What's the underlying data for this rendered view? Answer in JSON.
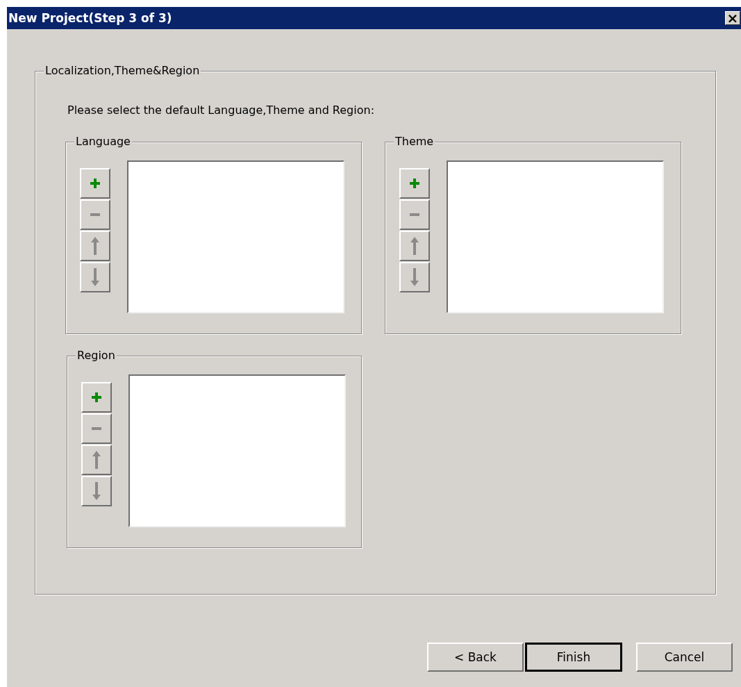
{
  "window": {
    "title": "New Project(Step 3 of 3)",
    "close": "×"
  },
  "group": {
    "legend": "Localization,Theme&Region",
    "instruction": "Please select the default Language,Theme and Region:",
    "lists": [
      {
        "legend": "Language",
        "tools": [
          {
            "kind": "add",
            "disabled": false
          },
          {
            "kind": "remove",
            "disabled": true
          },
          {
            "kind": "up",
            "disabled": true
          },
          {
            "kind": "down",
            "disabled": true
          }
        ]
      },
      {
        "legend": "Theme",
        "tools": [
          {
            "kind": "add",
            "disabled": false
          },
          {
            "kind": "remove",
            "disabled": true
          },
          {
            "kind": "up",
            "disabled": true
          },
          {
            "kind": "down",
            "disabled": true
          }
        ]
      },
      {
        "legend": "Region",
        "tools": [
          {
            "kind": "add",
            "disabled": false
          },
          {
            "kind": "remove",
            "disabled": true
          },
          {
            "kind": "up",
            "disabled": true
          },
          {
            "kind": "down",
            "disabled": true
          }
        ]
      }
    ]
  },
  "buttons": [
    {
      "label": "< Back",
      "default": false
    },
    {
      "label": "Finish",
      "default": true
    },
    {
      "label": "Cancel",
      "default": false
    }
  ]
}
